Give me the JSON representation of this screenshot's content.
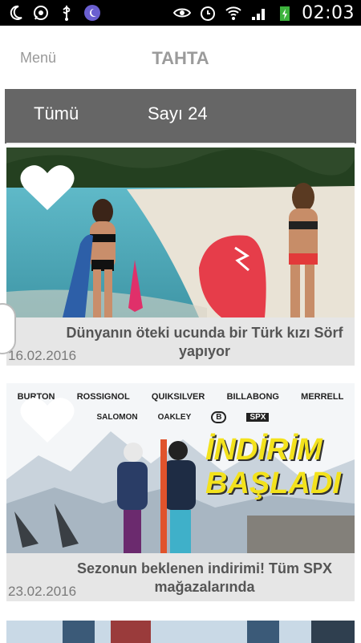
{
  "status_bar": {
    "time": "02:03",
    "left_icons": [
      "moon-icon",
      "whatsapp-icon",
      "usb-icon",
      "night-mode-icon"
    ],
    "right_icons": [
      "eye-icon",
      "alarm-icon",
      "wifi-icon",
      "signal-icon",
      "battery-charging-icon"
    ]
  },
  "header": {
    "menu_label": "Menü",
    "title": "TAHTA"
  },
  "tabs": {
    "all_label": "Tümü",
    "count_label": "Sayı 24"
  },
  "cards": [
    {
      "title": "Dünyanın öteki ucunda bir Türk kızı Sörf yapıyor",
      "date": "16.02.2016"
    },
    {
      "title": "Sezonun beklenen indirimi! Tüm SPX mağazalarında",
      "date": "23.02.2016",
      "banner_brands": [
        "BURTON",
        "ROSSIGNOL",
        "QUIKSILVER",
        "BILLABONG",
        "MERRELL",
        "SALOMON",
        "OAKLEY",
        "B",
        "SPX"
      ],
      "banner_text_line1": "İNDİRİM",
      "banner_text_line2": "BAŞLADI"
    }
  ],
  "colors": {
    "tab_bg": "#666666",
    "caption_bg": "#e6e6e6",
    "title_color": "#9b9b9b",
    "banner_yellow": "#f3e21c"
  }
}
